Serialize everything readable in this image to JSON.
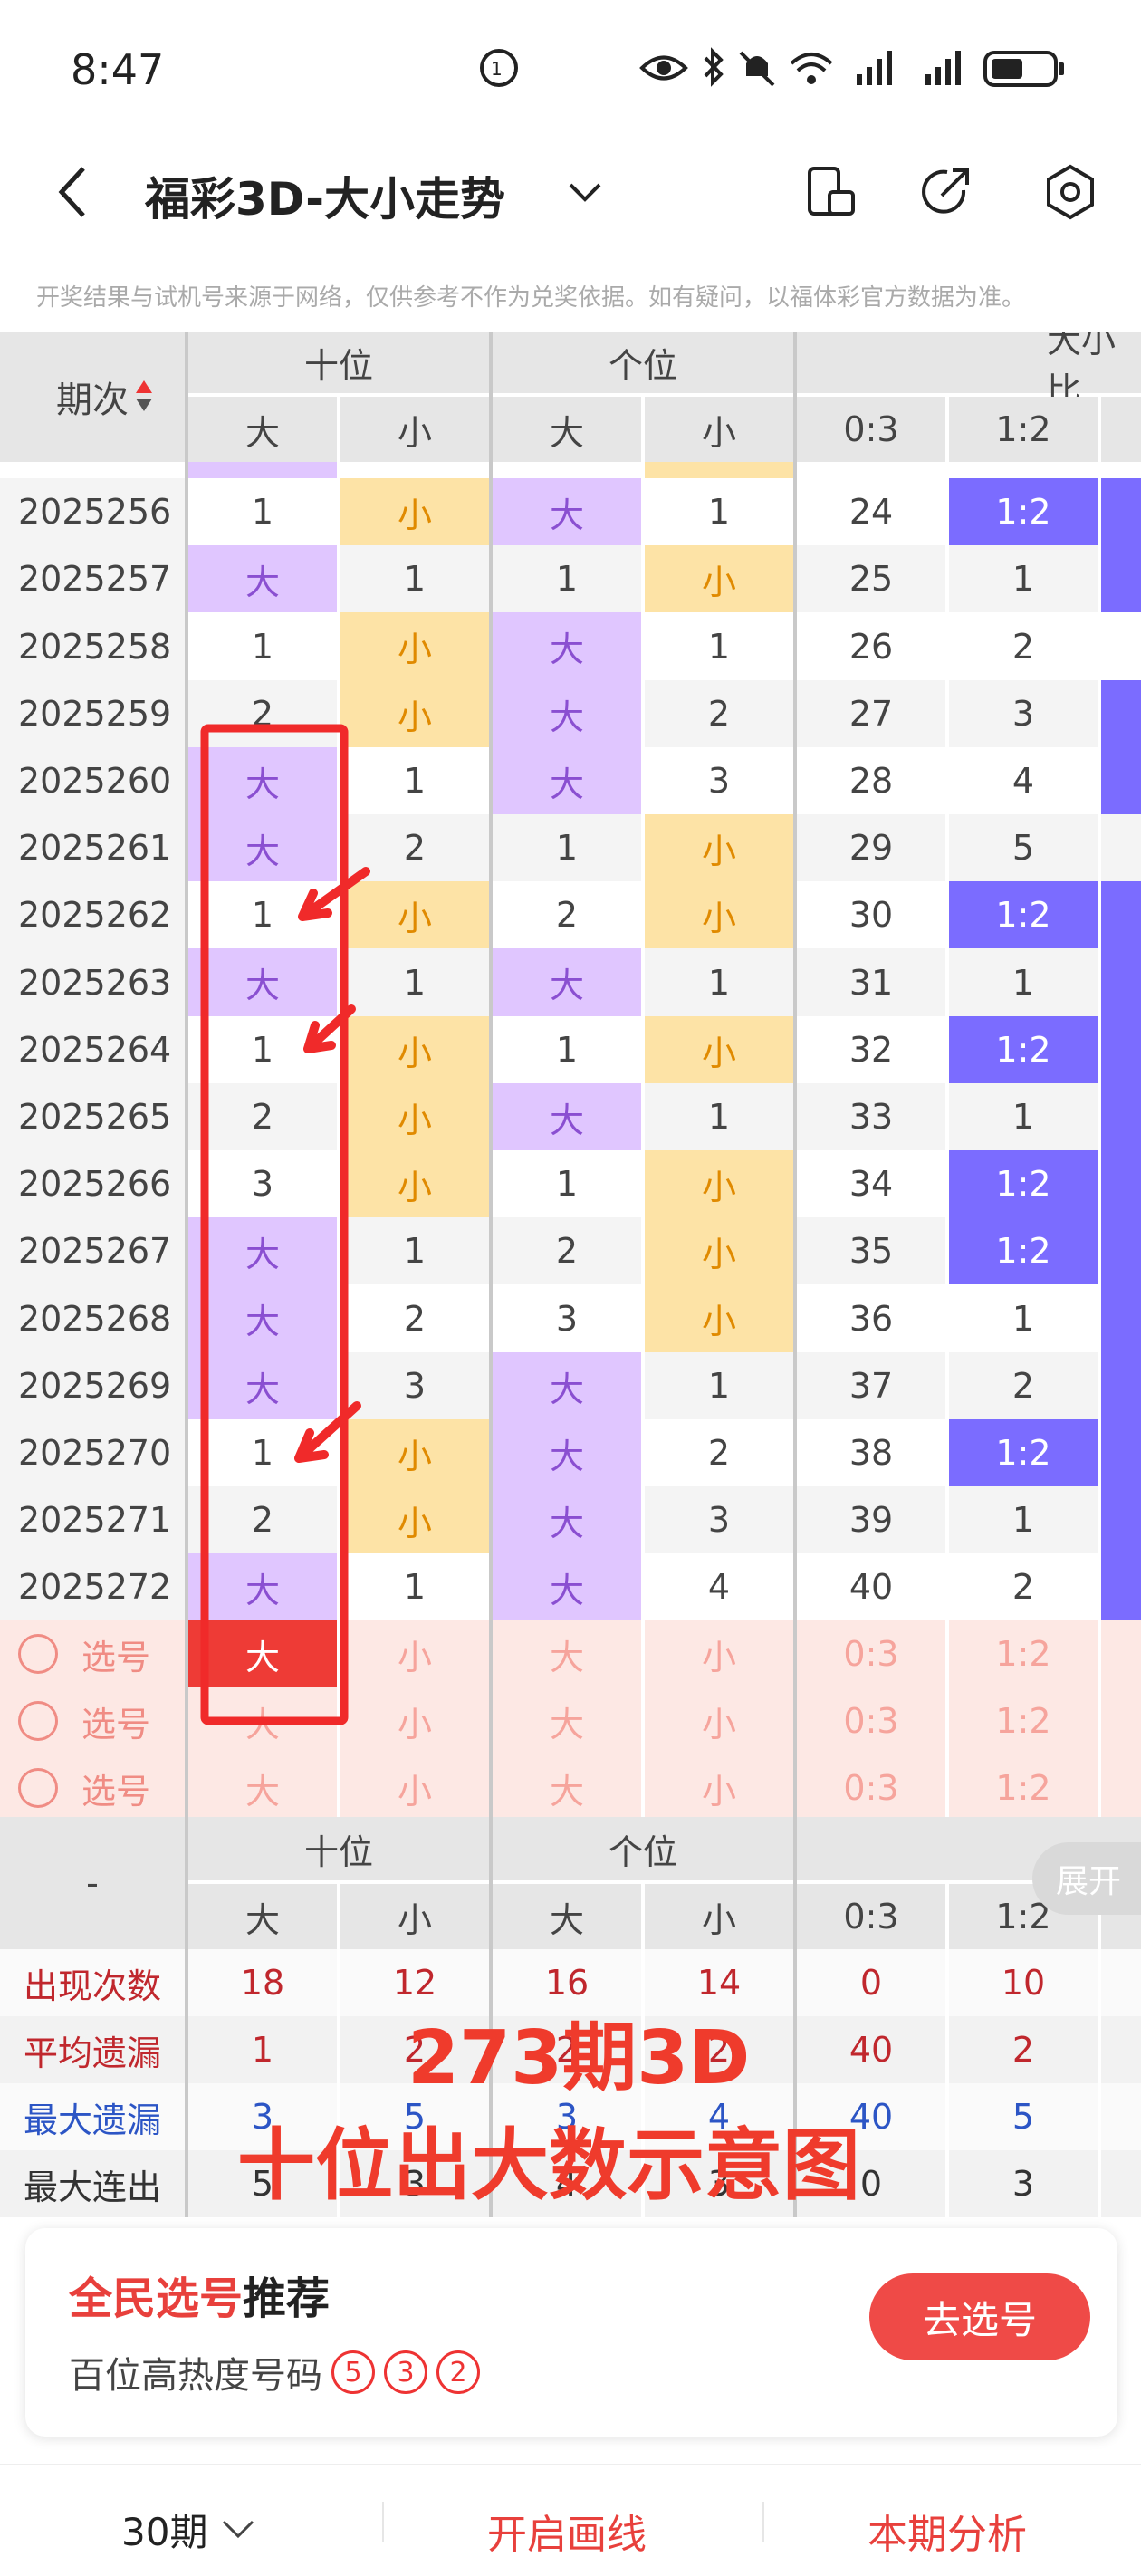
{
  "status_bar": {
    "time": "8:47"
  },
  "header": {
    "title": "福彩3D-大小走势"
  },
  "disclaimer": "开奖结果与试机号来源于网络，仅供参考不作为兑奖依据。如有疑问，以福体彩官方数据为准。",
  "table": {
    "period_label": "期次",
    "group_tens": "十位",
    "group_units": "个位",
    "group_ratio": "大小比",
    "col_big": "大",
    "col_small": "小",
    "col_r03": "0:3",
    "col_r12": "1:2",
    "rows": [
      {
        "p": "2025256",
        "tb": "1",
        "ts": "小",
        "ub": "大",
        "us": "1",
        "r03": "24",
        "r12": "1:2"
      },
      {
        "p": "2025257",
        "tb": "大",
        "ts": "1",
        "ub": "1",
        "us": "小",
        "r03": "25",
        "r12": "1"
      },
      {
        "p": "2025258",
        "tb": "1",
        "ts": "小",
        "ub": "大",
        "us": "1",
        "r03": "26",
        "r12": "2"
      },
      {
        "p": "2025259",
        "tb": "2",
        "ts": "小",
        "ub": "大",
        "us": "2",
        "r03": "27",
        "r12": "3"
      },
      {
        "p": "2025260",
        "tb": "大",
        "ts": "1",
        "ub": "大",
        "us": "3",
        "r03": "28",
        "r12": "4"
      },
      {
        "p": "2025261",
        "tb": "大",
        "ts": "2",
        "ub": "1",
        "us": "小",
        "r03": "29",
        "r12": "5"
      },
      {
        "p": "2025262",
        "tb": "1",
        "ts": "小",
        "ub": "2",
        "us": "小",
        "r03": "30",
        "r12": "1:2"
      },
      {
        "p": "2025263",
        "tb": "大",
        "ts": "1",
        "ub": "大",
        "us": "1",
        "r03": "31",
        "r12": "1"
      },
      {
        "p": "2025264",
        "tb": "1",
        "ts": "小",
        "ub": "1",
        "us": "小",
        "r03": "32",
        "r12": "1:2"
      },
      {
        "p": "2025265",
        "tb": "2",
        "ts": "小",
        "ub": "大",
        "us": "1",
        "r03": "33",
        "r12": "1"
      },
      {
        "p": "2025266",
        "tb": "3",
        "ts": "小",
        "ub": "1",
        "us": "小",
        "r03": "34",
        "r12": "1:2"
      },
      {
        "p": "2025267",
        "tb": "大",
        "ts": "1",
        "ub": "2",
        "us": "小",
        "r03": "35",
        "r12": "1:2"
      },
      {
        "p": "2025268",
        "tb": "大",
        "ts": "2",
        "ub": "3",
        "us": "小",
        "r03": "36",
        "r12": "1"
      },
      {
        "p": "2025269",
        "tb": "大",
        "ts": "3",
        "ub": "大",
        "us": "1",
        "r03": "37",
        "r12": "2"
      },
      {
        "p": "2025270",
        "tb": "1",
        "ts": "小",
        "ub": "大",
        "us": "2",
        "r03": "38",
        "r12": "1:2"
      },
      {
        "p": "2025271",
        "tb": "2",
        "ts": "小",
        "ub": "大",
        "us": "3",
        "r03": "39",
        "r12": "1"
      },
      {
        "p": "2025272",
        "tb": "大",
        "ts": "1",
        "ub": "大",
        "us": "4",
        "r03": "40",
        "r12": "2"
      }
    ],
    "pick_label": "选号"
  },
  "stats": {
    "expand": "展开",
    "dash": "-",
    "rows": [
      {
        "label": "出现次数",
        "vals": [
          "18",
          "12",
          "16",
          "14",
          "0",
          "10"
        ]
      },
      {
        "label": "平均遗漏",
        "vals": [
          "1",
          "2",
          "2",
          "2",
          "40",
          "2"
        ]
      },
      {
        "label": "最大遗漏",
        "vals": [
          "3",
          "5",
          "3",
          "4",
          "40",
          "5"
        ]
      },
      {
        "label": "最大连出",
        "vals": [
          "5",
          "3",
          "4",
          "3",
          "0",
          "3"
        ]
      }
    ]
  },
  "overlay": {
    "line1": "273期3D",
    "line2": "十位出大数示意图"
  },
  "promo": {
    "title_red": "全民选号",
    "title_dark": "推荐",
    "sub": "百位高热度号码",
    "nums": [
      "5",
      "3",
      "2"
    ],
    "button": "去选号"
  },
  "bottom": {
    "periods": "30期",
    "draw": "开启画线",
    "analysis": "本期分析"
  },
  "colors": {
    "purple": "#e0c6ff",
    "yellow": "#fde3a6",
    "blue": "#7b6cff",
    "red": "#e8403c",
    "pink": "#fde8e4"
  }
}
